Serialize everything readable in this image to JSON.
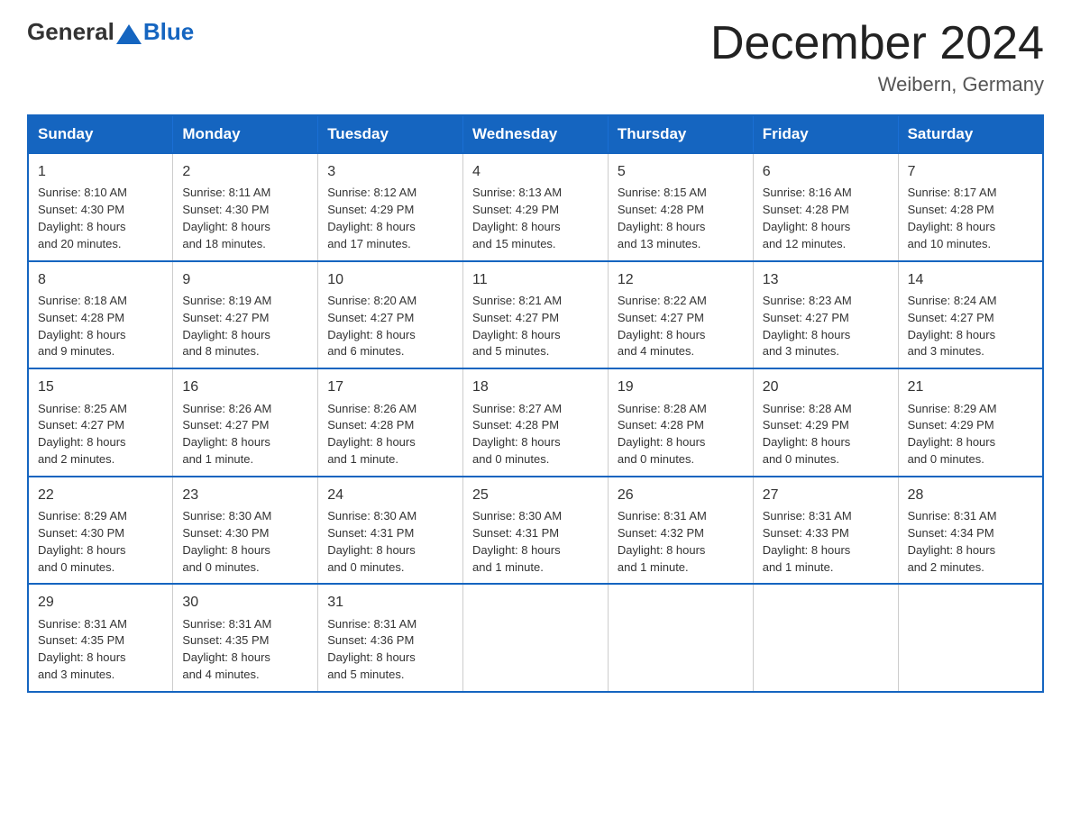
{
  "logo": {
    "general": "General",
    "blue": "Blue"
  },
  "title": "December 2024",
  "location": "Weibern, Germany",
  "days_of_week": [
    "Sunday",
    "Monday",
    "Tuesday",
    "Wednesday",
    "Thursday",
    "Friday",
    "Saturday"
  ],
  "weeks": [
    [
      {
        "day": "1",
        "sunrise": "8:10 AM",
        "sunset": "4:30 PM",
        "daylight": "8 hours and 20 minutes."
      },
      {
        "day": "2",
        "sunrise": "8:11 AM",
        "sunset": "4:30 PM",
        "daylight": "8 hours and 18 minutes."
      },
      {
        "day": "3",
        "sunrise": "8:12 AM",
        "sunset": "4:29 PM",
        "daylight": "8 hours and 17 minutes."
      },
      {
        "day": "4",
        "sunrise": "8:13 AM",
        "sunset": "4:29 PM",
        "daylight": "8 hours and 15 minutes."
      },
      {
        "day": "5",
        "sunrise": "8:15 AM",
        "sunset": "4:28 PM",
        "daylight": "8 hours and 13 minutes."
      },
      {
        "day": "6",
        "sunrise": "8:16 AM",
        "sunset": "4:28 PM",
        "daylight": "8 hours and 12 minutes."
      },
      {
        "day": "7",
        "sunrise": "8:17 AM",
        "sunset": "4:28 PM",
        "daylight": "8 hours and 10 minutes."
      }
    ],
    [
      {
        "day": "8",
        "sunrise": "8:18 AM",
        "sunset": "4:28 PM",
        "daylight": "8 hours and 9 minutes."
      },
      {
        "day": "9",
        "sunrise": "8:19 AM",
        "sunset": "4:27 PM",
        "daylight": "8 hours and 8 minutes."
      },
      {
        "day": "10",
        "sunrise": "8:20 AM",
        "sunset": "4:27 PM",
        "daylight": "8 hours and 6 minutes."
      },
      {
        "day": "11",
        "sunrise": "8:21 AM",
        "sunset": "4:27 PM",
        "daylight": "8 hours and 5 minutes."
      },
      {
        "day": "12",
        "sunrise": "8:22 AM",
        "sunset": "4:27 PM",
        "daylight": "8 hours and 4 minutes."
      },
      {
        "day": "13",
        "sunrise": "8:23 AM",
        "sunset": "4:27 PM",
        "daylight": "8 hours and 3 minutes."
      },
      {
        "day": "14",
        "sunrise": "8:24 AM",
        "sunset": "4:27 PM",
        "daylight": "8 hours and 3 minutes."
      }
    ],
    [
      {
        "day": "15",
        "sunrise": "8:25 AM",
        "sunset": "4:27 PM",
        "daylight": "8 hours and 2 minutes."
      },
      {
        "day": "16",
        "sunrise": "8:26 AM",
        "sunset": "4:27 PM",
        "daylight": "8 hours and 1 minute."
      },
      {
        "day": "17",
        "sunrise": "8:26 AM",
        "sunset": "4:28 PM",
        "daylight": "8 hours and 1 minute."
      },
      {
        "day": "18",
        "sunrise": "8:27 AM",
        "sunset": "4:28 PM",
        "daylight": "8 hours and 0 minutes."
      },
      {
        "day": "19",
        "sunrise": "8:28 AM",
        "sunset": "4:28 PM",
        "daylight": "8 hours and 0 minutes."
      },
      {
        "day": "20",
        "sunrise": "8:28 AM",
        "sunset": "4:29 PM",
        "daylight": "8 hours and 0 minutes."
      },
      {
        "day": "21",
        "sunrise": "8:29 AM",
        "sunset": "4:29 PM",
        "daylight": "8 hours and 0 minutes."
      }
    ],
    [
      {
        "day": "22",
        "sunrise": "8:29 AM",
        "sunset": "4:30 PM",
        "daylight": "8 hours and 0 minutes."
      },
      {
        "day": "23",
        "sunrise": "8:30 AM",
        "sunset": "4:30 PM",
        "daylight": "8 hours and 0 minutes."
      },
      {
        "day": "24",
        "sunrise": "8:30 AM",
        "sunset": "4:31 PM",
        "daylight": "8 hours and 0 minutes."
      },
      {
        "day": "25",
        "sunrise": "8:30 AM",
        "sunset": "4:31 PM",
        "daylight": "8 hours and 1 minute."
      },
      {
        "day": "26",
        "sunrise": "8:31 AM",
        "sunset": "4:32 PM",
        "daylight": "8 hours and 1 minute."
      },
      {
        "day": "27",
        "sunrise": "8:31 AM",
        "sunset": "4:33 PM",
        "daylight": "8 hours and 1 minute."
      },
      {
        "day": "28",
        "sunrise": "8:31 AM",
        "sunset": "4:34 PM",
        "daylight": "8 hours and 2 minutes."
      }
    ],
    [
      {
        "day": "29",
        "sunrise": "8:31 AM",
        "sunset": "4:35 PM",
        "daylight": "8 hours and 3 minutes."
      },
      {
        "day": "30",
        "sunrise": "8:31 AM",
        "sunset": "4:35 PM",
        "daylight": "8 hours and 4 minutes."
      },
      {
        "day": "31",
        "sunrise": "8:31 AM",
        "sunset": "4:36 PM",
        "daylight": "8 hours and 5 minutes."
      },
      null,
      null,
      null,
      null
    ]
  ],
  "labels": {
    "sunrise": "Sunrise:",
    "sunset": "Sunset:",
    "daylight": "Daylight:"
  }
}
